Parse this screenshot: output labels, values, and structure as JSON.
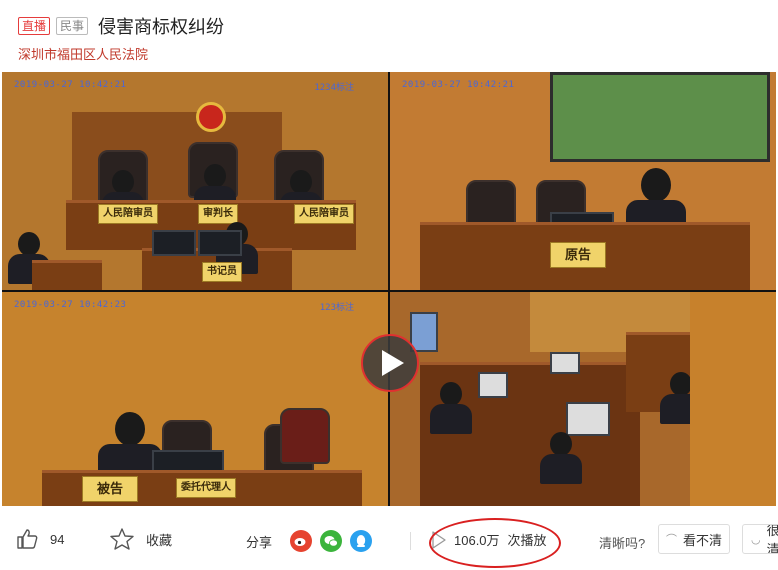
{
  "header": {
    "tag_live": "直播",
    "tag_category": "民事",
    "title": "侵害商标权纠纷",
    "court": "深圳市福田区人民法院"
  },
  "video": {
    "timestamps": [
      "2019-03-27 10:42:21",
      "2019-03-27 10:42:21",
      "2019-03-27 10:42:23"
    ],
    "camera_labels": [
      "1234标注",
      "123标注"
    ],
    "placards": {
      "judge_left": "人民陪审员",
      "judge_center": "审判长",
      "judge_right": "人民陪审员",
      "clerk": "书记员",
      "plaintiff": "原告",
      "defendant": "被告",
      "agent": "委托代理人"
    },
    "play_icon": "play-icon"
  },
  "toolbar": {
    "like_count": "94",
    "favorite_label": "收藏",
    "share_label": "分享",
    "play_count": "106.0万",
    "play_unit": "次播放",
    "clarity_question": "清晰吗?",
    "unclear_label": "看不清",
    "clear_label": "很清"
  },
  "colors": {
    "accent_red": "#e53c3c",
    "weibo": "#e6432f",
    "wechat": "#3bb43c",
    "qq": "#2aa1ef"
  }
}
